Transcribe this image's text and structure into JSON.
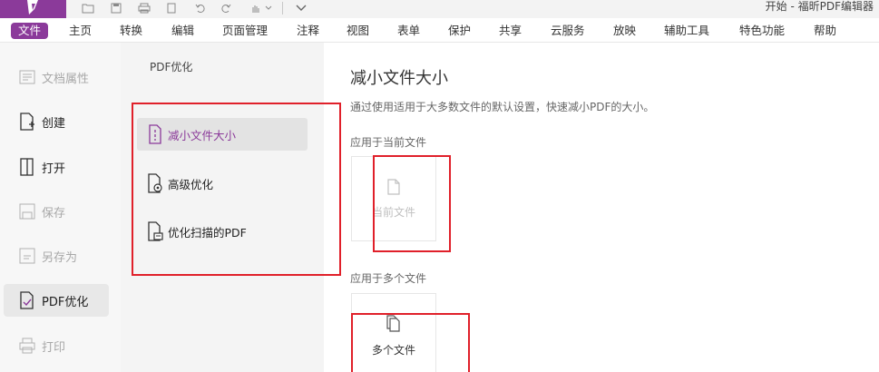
{
  "window": {
    "title": "开始 - 福昕PDF编辑器"
  },
  "menu": {
    "items": [
      "文件",
      "主页",
      "转换",
      "编辑",
      "页面管理",
      "注释",
      "视图",
      "表单",
      "保护",
      "共享",
      "云服务",
      "放映",
      "辅助工具",
      "特色功能",
      "帮助"
    ]
  },
  "sidebar": {
    "items": [
      {
        "label": "文档属性",
        "icon": "document-properties-icon"
      },
      {
        "label": "创建",
        "icon": "create-icon"
      },
      {
        "label": "打开",
        "icon": "open-icon"
      },
      {
        "label": "保存",
        "icon": "save-icon"
      },
      {
        "label": "另存为",
        "icon": "save-as-icon"
      },
      {
        "label": "PDF优化",
        "icon": "pdf-optimize-icon"
      },
      {
        "label": "打印",
        "icon": "print-icon"
      }
    ]
  },
  "panel": {
    "title": "PDF优化",
    "options": [
      {
        "label": "减小文件大小",
        "icon": "reduce-size-icon"
      },
      {
        "label": "高级优化",
        "icon": "advanced-optimize-icon"
      },
      {
        "label": "优化扫描的PDF",
        "icon": "optimize-scan-icon"
      }
    ]
  },
  "content": {
    "title": "减小文件大小",
    "description": "通过使用适用于大多数文件的默认设置，快速减小PDF的大小。",
    "current_heading": "应用于当前文件",
    "current_card_label": "当前文件",
    "multi_heading": "应用于多个文件",
    "multi_card_label": "多个文件"
  },
  "colors": {
    "accent": "#8b3a9a",
    "annotation": "#e0202a"
  }
}
